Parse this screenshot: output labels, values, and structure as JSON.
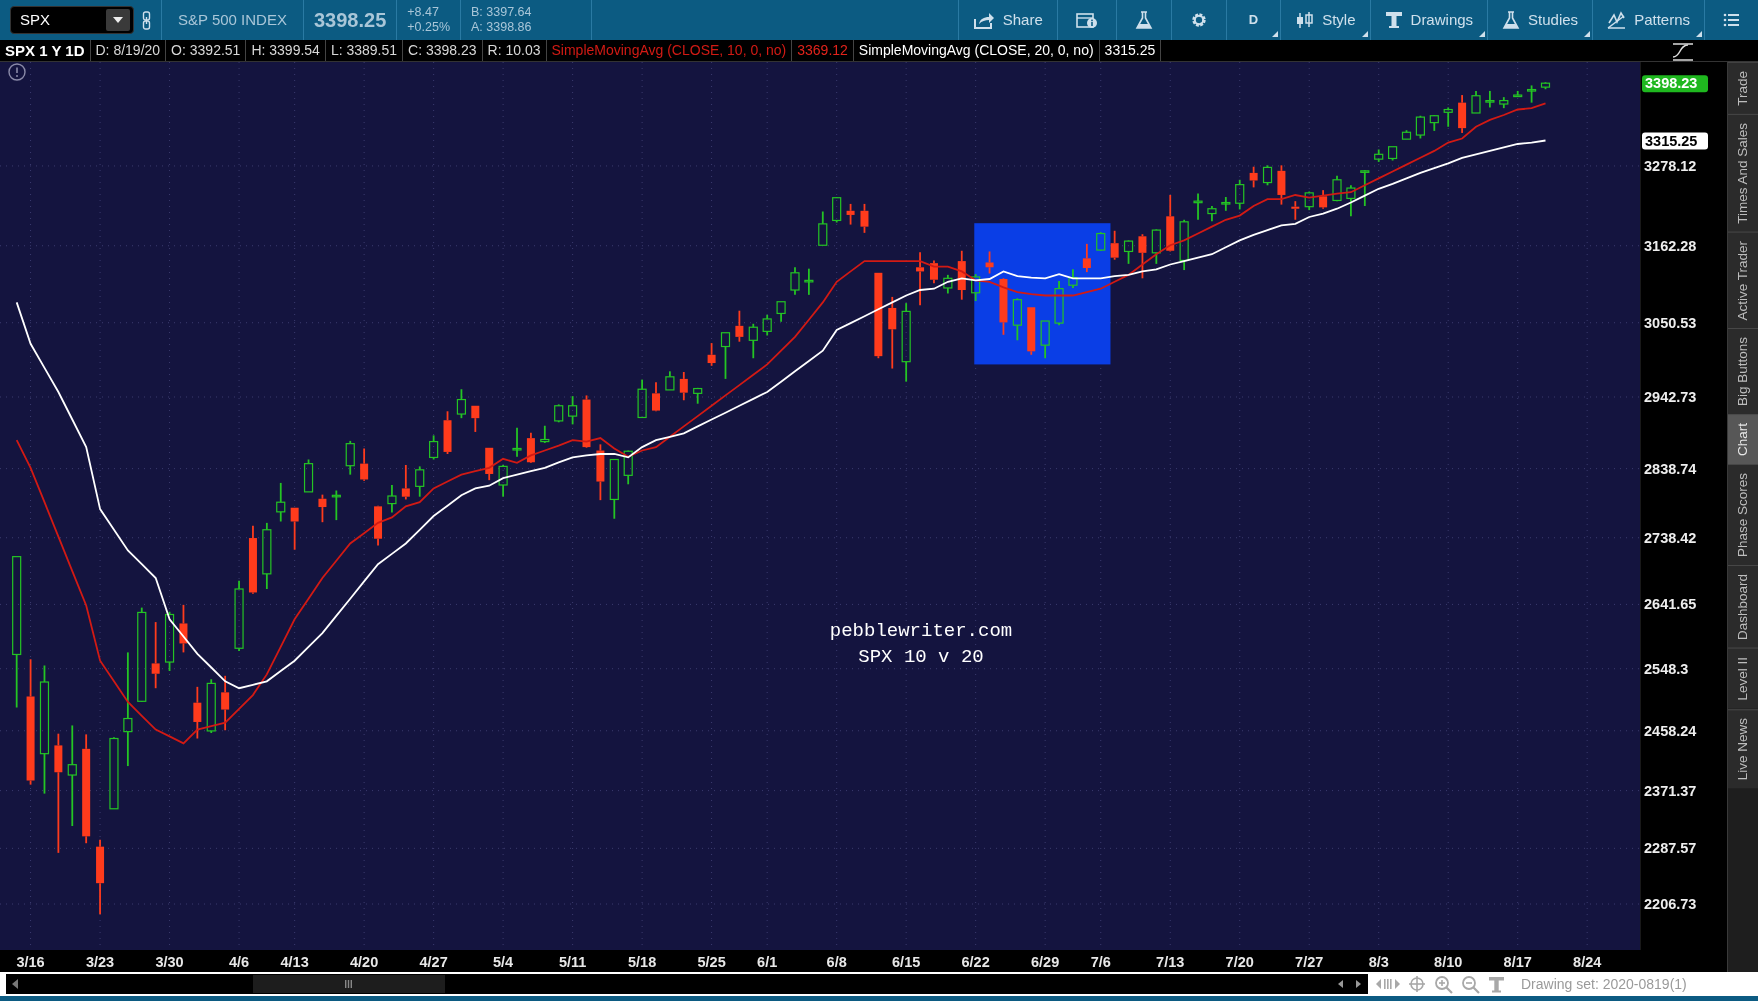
{
  "toolbar": {
    "symbol": "SPX",
    "description": "S&P 500 INDEX",
    "last": "3398.25",
    "change": "+8.47",
    "change_percent": "+0.25%",
    "bid": "B: 3397.64",
    "ask": "A: 3398.86",
    "buttons": [
      {
        "kind": "share",
        "label": "Share"
      },
      {
        "kind": "info"
      },
      {
        "kind": "flask"
      },
      {
        "kind": "gear"
      },
      {
        "kind": "text",
        "label": "D"
      },
      {
        "kind": "style",
        "label": "Style"
      },
      {
        "kind": "drawings",
        "label": "Drawings"
      },
      {
        "kind": "flask",
        "label": "Studies"
      },
      {
        "kind": "patterns",
        "label": "Patterns"
      },
      {
        "kind": "menu"
      }
    ]
  },
  "info_bar": [
    {
      "kind": "title",
      "text": "SPX 1 Y 1D"
    },
    {
      "kind": "plain",
      "text": "D: 8/19/20"
    },
    {
      "kind": "plain",
      "text": "O: 3392.51"
    },
    {
      "kind": "plain",
      "text": "H: 3399.54"
    },
    {
      "kind": "plain",
      "text": "L: 3389.51"
    },
    {
      "kind": "plain",
      "text": "C: 3398.23"
    },
    {
      "kind": "plain",
      "text": "R: 10.03"
    },
    {
      "kind": "fast_study",
      "text": "3369.12"
    },
    {
      "kind": "slow_study",
      "text": "3315.25"
    }
  ],
  "chart": {
    "chart_data": {
      "type": "candlestick",
      "grid": true,
      "ylim": [
        2140,
        3429
      ],
      "categories": [
        null,
        "3/16",
        null,
        null,
        null,
        null,
        "3/23",
        null,
        null,
        null,
        null,
        "3/30",
        null,
        null,
        null,
        null,
        "4/6",
        null,
        null,
        null,
        "4/13",
        null,
        null,
        null,
        null,
        "4/20",
        null,
        null,
        null,
        null,
        "4/27",
        null,
        null,
        null,
        null,
        "5/4",
        null,
        null,
        null,
        null,
        "5/11",
        null,
        null,
        null,
        null,
        "5/18",
        null,
        null,
        null,
        null,
        "5/25",
        null,
        null,
        null,
        "6/1",
        null,
        null,
        null,
        null,
        "6/8",
        null,
        null,
        null,
        null,
        "6/15",
        null,
        null,
        null,
        null,
        "6/22",
        null,
        null,
        null,
        null,
        "6/29",
        null,
        null,
        null,
        "7/6",
        null,
        null,
        null,
        null,
        "7/13",
        null,
        null,
        null,
        null,
        "7/20",
        null,
        null,
        null,
        null,
        "7/27",
        null,
        null,
        null,
        null,
        "8/3",
        null,
        null,
        null,
        null,
        "8/10",
        null,
        null,
        null,
        null,
        "8/17",
        null,
        null,
        null,
        null,
        "8/24"
      ],
      "ohlc": [
        [
          2569,
          2711,
          2492,
          2711
        ],
        [
          2508,
          2562,
          2380,
          2386
        ],
        [
          2425,
          2553,
          2367,
          2529
        ],
        [
          2437,
          2454,
          2281,
          2398
        ],
        [
          2394,
          2466,
          2320,
          2409
        ],
        [
          2432,
          2453,
          2295,
          2305
        ],
        [
          2290,
          2300,
          2192,
          2237
        ],
        [
          2345,
          2449,
          2345,
          2447
        ],
        [
          2457,
          2572,
          2407,
          2476
        ],
        [
          2501,
          2637,
          2500,
          2630
        ],
        [
          2556,
          2616,
          2520,
          2541
        ],
        [
          2558,
          2631,
          2545,
          2627
        ],
        [
          2614,
          2641,
          2572,
          2585
        ],
        [
          2499,
          2522,
          2447,
          2471
        ],
        [
          2458,
          2533,
          2455,
          2527
        ],
        [
          2514,
          2538,
          2459,
          2489
        ],
        [
          2578,
          2676,
          2574,
          2664
        ],
        [
          2738,
          2756,
          2657,
          2659
        ],
        [
          2686,
          2760,
          2664,
          2750
        ],
        [
          2776,
          2818,
          2762,
          2790
        ],
        [
          2782,
          2782,
          2721,
          2762
        ],
        [
          2805,
          2852,
          2805,
          2846
        ],
        [
          2795,
          2801,
          2761,
          2783
        ],
        [
          2799,
          2807,
          2764,
          2800
        ],
        [
          2843,
          2879,
          2830,
          2875
        ],
        [
          2846,
          2868,
          2821,
          2823
        ],
        [
          2784,
          2785,
          2727,
          2737
        ],
        [
          2788,
          2815,
          2775,
          2799
        ],
        [
          2810,
          2844,
          2794,
          2798
        ],
        [
          2813,
          2842,
          2798,
          2837
        ],
        [
          2855,
          2887,
          2852,
          2878
        ],
        [
          2909,
          2922,
          2860,
          2863
        ],
        [
          2918,
          2954,
          2912,
          2939
        ],
        [
          2930,
          2930,
          2892,
          2912
        ],
        [
          2869,
          2869,
          2822,
          2831
        ],
        [
          2815,
          2844,
          2798,
          2842
        ],
        [
          2868,
          2898,
          2856,
          2868
        ],
        [
          2883,
          2891,
          2847,
          2848
        ],
        [
          2878,
          2901,
          2876,
          2881
        ],
        [
          2908,
          2932,
          2906,
          2930
        ],
        [
          2915,
          2944,
          2903,
          2930
        ],
        [
          2939,
          2945,
          2869,
          2870
        ],
        [
          2865,
          2874,
          2793,
          2820
        ],
        [
          2794,
          2852,
          2766,
          2852
        ],
        [
          2829,
          2865,
          2816,
          2864
        ],
        [
          2913,
          2968,
          2913,
          2954
        ],
        [
          2948,
          2964,
          2922,
          2923
        ],
        [
          2953,
          2980,
          2953,
          2972
        ],
        [
          2969,
          2979,
          2938,
          2949
        ],
        [
          2948,
          2956,
          2933,
          2955
        ],
        [
          3004,
          3021,
          2988,
          2992
        ],
        [
          3016,
          3036,
          2969,
          3036
        ],
        [
          3046,
          3068,
          3023,
          3030
        ],
        [
          3025,
          3049,
          2999,
          3044
        ],
        [
          3038,
          3062,
          3032,
          3056
        ],
        [
          3064,
          3081,
          3052,
          3081
        ],
        [
          3098,
          3131,
          3091,
          3123
        ],
        [
          3111,
          3129,
          3091,
          3112
        ],
        [
          3163,
          3212,
          3163,
          3194
        ],
        [
          3199,
          3233,
          3196,
          3232
        ],
        [
          3213,
          3223,
          3193,
          3207
        ],
        [
          3213,
          3223,
          3181,
          3190
        ],
        [
          3123,
          3123,
          2999,
          3002
        ],
        [
          3072,
          3088,
          2984,
          3041
        ],
        [
          2994,
          3079,
          2965,
          3067
        ],
        [
          3131,
          3153,
          3076,
          3125
        ],
        [
          3137,
          3141,
          3108,
          3113
        ],
        [
          3101,
          3120,
          3093,
          3115
        ],
        [
          3140,
          3155,
          3084,
          3098
        ],
        [
          3094,
          3121,
          3082,
          3117
        ],
        [
          3138,
          3154,
          3122,
          3131
        ],
        [
          3114,
          3115,
          3033,
          3051
        ],
        [
          3047,
          3086,
          3025,
          3084
        ],
        [
          3073,
          3073,
          3004,
          3009
        ],
        [
          3018,
          3053,
          2999,
          3053
        ],
        [
          3050,
          3111,
          3047,
          3100
        ],
        [
          3105,
          3128,
          3101,
          3116
        ],
        [
          3144,
          3165,
          3124,
          3130
        ],
        [
          3156,
          3182,
          3155,
          3180
        ],
        [
          3166,
          3184,
          3142,
          3145
        ],
        [
          3154,
          3170,
          3136,
          3169
        ],
        [
          3176,
          3179,
          3115,
          3152
        ],
        [
          3152,
          3186,
          3136,
          3185
        ],
        [
          3205,
          3236,
          3154,
          3155
        ],
        [
          3141,
          3200,
          3127,
          3197
        ],
        [
          3225,
          3238,
          3200,
          3227
        ],
        [
          3209,
          3220,
          3198,
          3216
        ],
        [
          3224,
          3233,
          3213,
          3225
        ],
        [
          3224,
          3258,
          3215,
          3251
        ],
        [
          3268,
          3277,
          3247,
          3257
        ],
        [
          3254,
          3279,
          3250,
          3276
        ],
        [
          3271,
          3279,
          3222,
          3236
        ],
        [
          3219,
          3227,
          3200,
          3216
        ],
        [
          3219,
          3241,
          3214,
          3239
        ],
        [
          3234,
          3243,
          3216,
          3218
        ],
        [
          3228,
          3264,
          3227,
          3258
        ],
        [
          3231,
          3250,
          3205,
          3246
        ],
        [
          3270,
          3272,
          3220,
          3271
        ],
        [
          3288,
          3302,
          3284,
          3295
        ],
        [
          3289,
          3306,
          3286,
          3306
        ],
        [
          3317,
          3330,
          3317,
          3327
        ],
        [
          3323,
          3351,
          3318,
          3349
        ],
        [
          3341,
          3352,
          3329,
          3351
        ],
        [
          3356,
          3363,
          3335,
          3360
        ],
        [
          3370,
          3381,
          3326,
          3333
        ],
        [
          3355,
          3387,
          3355,
          3380
        ],
        [
          3372,
          3387,
          3363,
          3373
        ],
        [
          3368,
          3378,
          3362,
          3373
        ],
        [
          3380,
          3387,
          3379,
          3381
        ],
        [
          3388,
          3395,
          3370,
          3389
        ],
        [
          3392.51,
          3399.54,
          3389.51,
          3398.23
        ],
        null,
        null,
        null
      ],
      "series": [
        {
          "name": "SimpleMovingAvg (CLOSE, 10, 0, no)",
          "type": "line",
          "color": "#d21a14",
          "values": [
            2880,
            2840,
            2790,
            2740,
            2690,
            2640,
            2560,
            2530,
            2500,
            2480,
            2460,
            2450,
            2440,
            2460,
            2465,
            2470,
            2490,
            2510,
            2540,
            2580,
            2620,
            2650,
            2680,
            2705,
            2730,
            2745,
            2760,
            2768,
            2784,
            2790,
            2810,
            2820,
            2830,
            2835,
            2840,
            2853,
            2847,
            2858,
            2865,
            2872,
            2880,
            2878,
            2883,
            2868,
            2856,
            2865,
            2870,
            2885,
            2900,
            2915,
            2930,
            2945,
            2960,
            2975,
            2990,
            3010,
            3030,
            3055,
            3080,
            3110,
            3125,
            3140,
            3140,
            3140,
            3140,
            3140,
            3132,
            3132,
            3125,
            3112,
            3110,
            3102,
            3095,
            3092,
            3090,
            3090,
            3090,
            3095,
            3100,
            3110,
            3120,
            3135,
            3150,
            3163,
            3170,
            3180,
            3190,
            3200,
            3206,
            3220,
            3230,
            3230,
            3236,
            3232,
            3235,
            3238,
            3240,
            3250,
            3260,
            3270,
            3280,
            3290,
            3300,
            3312,
            3318,
            3335,
            3345,
            3352,
            3360,
            3362,
            3369,
            null,
            null,
            null
          ]
        },
        {
          "name": "SimpleMovingAvg (CLOSE, 20, 0, no)",
          "type": "line",
          "color": "#ffffff",
          "values": [
            3080,
            3020,
            2985,
            2950,
            2910,
            2870,
            2780,
            2750,
            2720,
            2700,
            2680,
            2620,
            2595,
            2570,
            2550,
            2530,
            2520,
            2525,
            2530,
            2545,
            2560,
            2580,
            2600,
            2625,
            2650,
            2675,
            2700,
            2715,
            2730,
            2750,
            2770,
            2785,
            2800,
            2810,
            2814,
            2825,
            2830,
            2835,
            2840,
            2848,
            2855,
            2858,
            2860,
            2860,
            2855,
            2870,
            2880,
            2885,
            2890,
            2900,
            2910,
            2920,
            2930,
            2940,
            2950,
            2965,
            2980,
            2995,
            3010,
            3040,
            3050,
            3060,
            3070,
            3080,
            3090,
            3098,
            3100,
            3110,
            3115,
            3112,
            3114,
            3125,
            3118,
            3116,
            3115,
            3121,
            3115,
            3115,
            3115,
            3118,
            3120,
            3125,
            3128,
            3135,
            3140,
            3145,
            3150,
            3160,
            3170,
            3178,
            3185,
            3192,
            3194,
            3204,
            3209,
            3216,
            3225,
            3235,
            3245,
            3252,
            3260,
            3268,
            3275,
            3282,
            3290,
            3295,
            3300,
            3305,
            3310,
            3312,
            3315,
            null,
            null,
            null
          ]
        }
      ],
      "yticks": [
        {
          "value": 2206.73,
          "label": "2206.73"
        },
        {
          "value": 2287.57,
          "label": "2287.57"
        },
        {
          "value": 2371.37,
          "label": "2371.37"
        },
        {
          "value": 2458.24,
          "label": "2458.24"
        },
        {
          "value": 2548.3,
          "label": "2548.3"
        },
        {
          "value": 2641.65,
          "label": "2641.65"
        },
        {
          "value": 2738.42,
          "label": "2738.42"
        },
        {
          "value": 2838.74,
          "label": "2838.74"
        },
        {
          "value": 2942.73,
          "label": "2942.73"
        },
        {
          "value": 3050.53,
          "label": "3050.53"
        },
        {
          "value": 3162.28,
          "label": "3162.28"
        },
        {
          "value": 3278.12,
          "label": "3278.12"
        }
      ],
      "annotations": [
        "pebblewriter.com",
        "SPX 10 v 20"
      ]
    },
    "price_badges": [
      {
        "text": "3398.23",
        "color": "#1fb81f"
      },
      {
        "text": "3315.25",
        "color": "#ffffff"
      }
    ]
  },
  "side_tabs": [
    {
      "label": "Trade",
      "selected": false
    },
    {
      "label": "Times And Sales",
      "selected": false
    },
    {
      "label": "Active Trader",
      "selected": false
    },
    {
      "label": "Big Buttons",
      "selected": false
    },
    {
      "label": "Chart",
      "selected": true
    },
    {
      "label": "Phase Scores",
      "selected": false
    },
    {
      "label": "Dashboard",
      "selected": false
    },
    {
      "label": "Level II",
      "selected": false
    },
    {
      "label": "Live News",
      "selected": false
    }
  ],
  "bottom_bar": {
    "drawing_set": "Drawing set: 2020-0819(1)"
  }
}
